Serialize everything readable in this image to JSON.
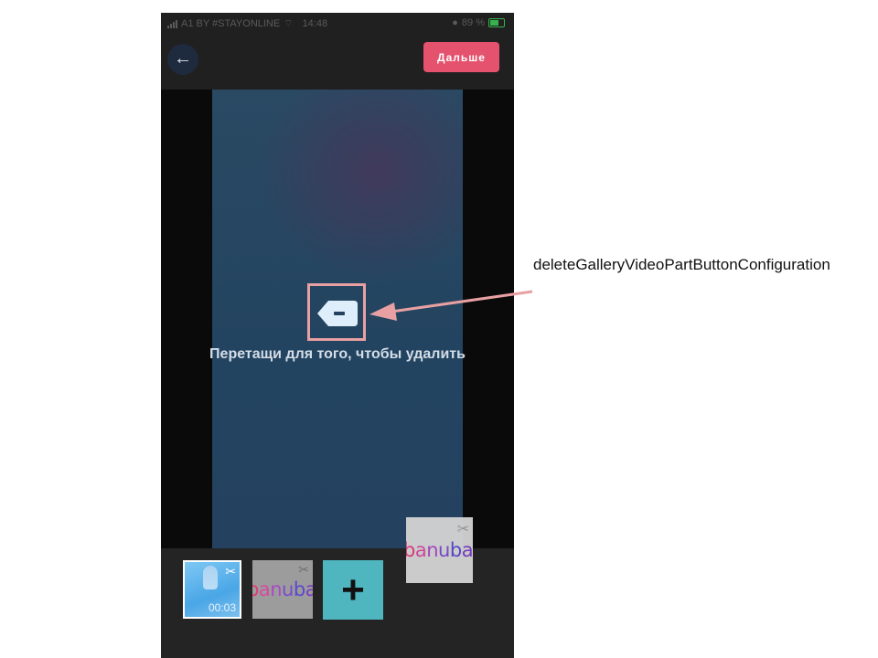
{
  "status_bar": {
    "carrier": "A1 BY #STAYONLINE",
    "time": "14:48",
    "battery": "89 %"
  },
  "header": {
    "back_icon": "arrow-left-icon",
    "next_label": "Дальше"
  },
  "preview": {
    "delete_icon": "delete-backspace-icon",
    "hint": "Перетащи для того, чтобы удалить"
  },
  "timeline": {
    "clips": [
      {
        "duration": "00:03",
        "icon": "scissors-icon"
      },
      {
        "logo": "banuba",
        "icon": "scissors-icon"
      }
    ],
    "add_icon": "plus-icon",
    "add_label": "+",
    "dragged_clip": {
      "logo": "banuba",
      "icon": "scissors-icon"
    }
  },
  "annotation": {
    "label": "deleteGalleryVideoPartButtonConfiguration",
    "color": "#e8a0a3"
  },
  "colors": {
    "accent": "#e4526e",
    "add_button": "#4fb5bf"
  }
}
